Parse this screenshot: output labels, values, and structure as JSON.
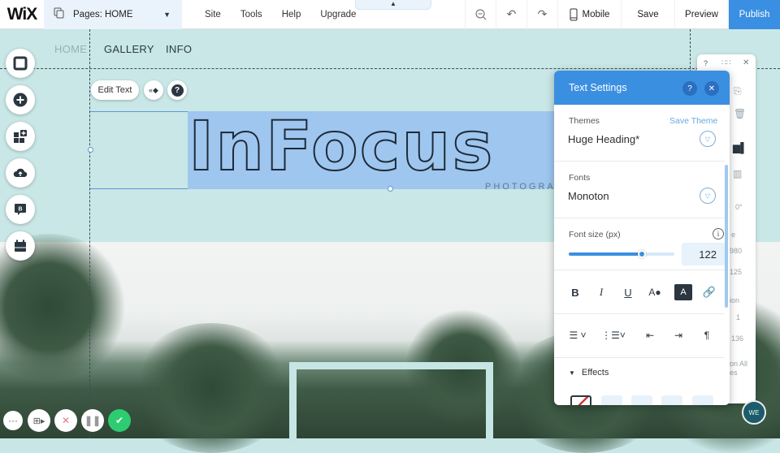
{
  "topbar": {
    "logo": "WiX",
    "pages_label": "Pages: HOME",
    "menu": [
      "Site",
      "Tools",
      "Help",
      "Upgrade"
    ],
    "mobile_label": "Mobile",
    "save_label": "Save",
    "preview_label": "Preview",
    "publish_label": "Publish",
    "publish_color": "#3a8fe2"
  },
  "site_nav": [
    "HOME",
    "GALLERY",
    "INFO"
  ],
  "left_tools": [
    "background",
    "add",
    "add-apps",
    "upload",
    "blog",
    "bookings"
  ],
  "edit_bar": {
    "edit_text_label": "Edit Text",
    "help": "?"
  },
  "canvas": {
    "heading_text": "InFocus",
    "subheading_text": "PHOTOGRA"
  },
  "mini_panel": {
    "help": "?",
    "rotation": "0°",
    "partial_texts": [
      "e",
      "980",
      "125",
      "ion",
      "1",
      "136",
      "on All",
      "es"
    ]
  },
  "text_settings": {
    "title": "Text Settings",
    "themes_label": "Themes",
    "save_theme_label": "Save Theme",
    "theme_value": "Huge Heading*",
    "fonts_label": "Fonts",
    "font_value": "Monoton",
    "font_size_label": "Font size (px)",
    "font_size_value": "122",
    "font_size_slider_fraction": 0.69,
    "format_buttons": [
      "B",
      "I",
      "U"
    ],
    "effects_label": "Effects"
  },
  "recorder": {
    "accent": "#2ecc71"
  },
  "avatar_text": "WE"
}
